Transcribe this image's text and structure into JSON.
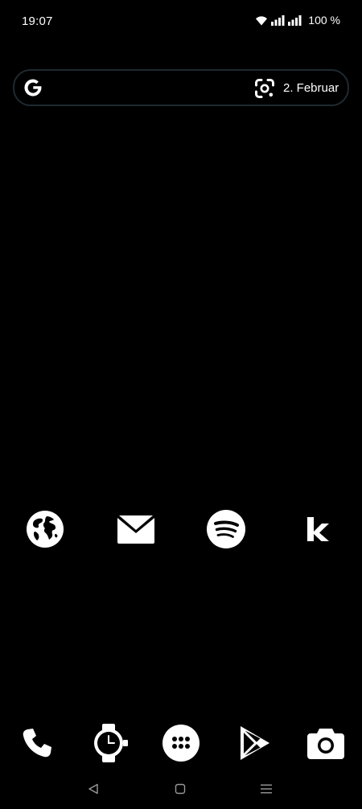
{
  "status_bar": {
    "time": "19:07",
    "battery": "100 %",
    "icons": [
      "wifi-icon",
      "signal-icon",
      "signal-icon"
    ]
  },
  "search_widget": {
    "date": "2. Februar",
    "icons": [
      "google-g-icon",
      "google-lens-icon"
    ]
  },
  "home_apps": [
    {
      "icon": "globe-icon"
    },
    {
      "icon": "mail-icon"
    },
    {
      "icon": "spotify-icon"
    },
    {
      "icon": "k-logo-icon"
    }
  ],
  "dock_apps": [
    {
      "icon": "phone-icon"
    },
    {
      "icon": "watch-icon"
    },
    {
      "icon": "app-drawer-icon"
    },
    {
      "icon": "play-store-icon"
    },
    {
      "icon": "camera-icon"
    }
  ],
  "nav_bar": {
    "buttons": [
      "back-icon",
      "home-icon",
      "recents-icon"
    ]
  },
  "colors": {
    "background": "#000000",
    "foreground": "#ffffff",
    "search_border": "#1e2a2f"
  }
}
